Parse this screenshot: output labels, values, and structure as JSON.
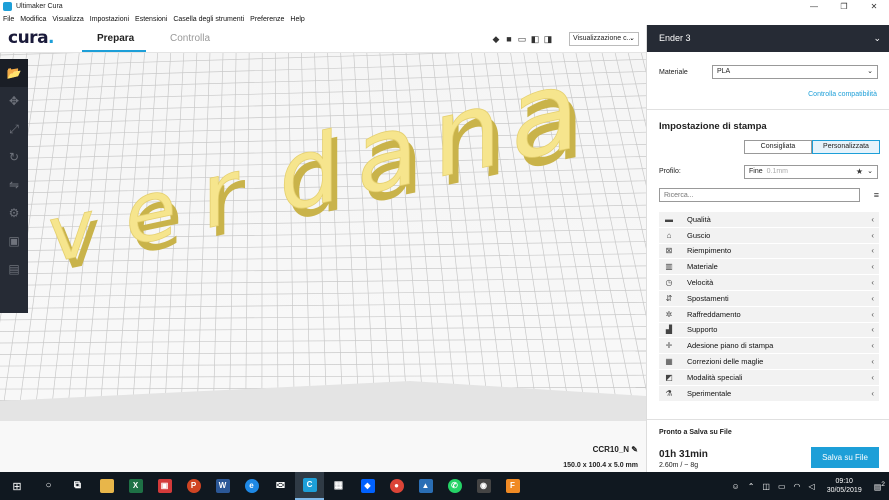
{
  "window": {
    "title": "Ultimaker Cura",
    "controls": [
      "—",
      "❐",
      "✕"
    ]
  },
  "menu": [
    "File",
    "Modifica",
    "Visualizza",
    "Impostazioni",
    "Estensioni",
    "Casella degli strumenti",
    "Preferenze",
    "Help"
  ],
  "header": {
    "logo": "cura",
    "logo_dot": ".",
    "tabs": [
      {
        "label": "Prepara",
        "active": true
      },
      {
        "label": "Controlla",
        "active": false
      }
    ],
    "view_select": "Visualizzazione c..."
  },
  "viewport": {
    "model_text": "verdana",
    "model_color": "#f6e58d",
    "model_name": "CCR10_N",
    "model_dims": "150.0 x 100.4 x 5.0 mm"
  },
  "panel": {
    "printer": "Ender 3",
    "material_label": "Materiale",
    "material_value": "PLA",
    "compat_link": "Controlla compatibilità",
    "section_title": "Impostazione di stampa",
    "mode_recommended": "Consigliata",
    "mode_custom": "Personalizzata",
    "profile_label": "Profilo:",
    "profile_value": "Fine",
    "profile_sub": "0.1mm",
    "search_placeholder": "Ricerca...",
    "categories": [
      {
        "label": "Qualità",
        "icon": "quality-icon"
      },
      {
        "label": "Guscio",
        "icon": "shell-icon"
      },
      {
        "label": "Riempimento",
        "icon": "infill-icon"
      },
      {
        "label": "Materiale",
        "icon": "material-icon"
      },
      {
        "label": "Velocità",
        "icon": "speed-icon"
      },
      {
        "label": "Spostamenti",
        "icon": "travel-icon"
      },
      {
        "label": "Raffreddamento",
        "icon": "cooling-icon"
      },
      {
        "label": "Supporto",
        "icon": "support-icon"
      },
      {
        "label": "Adesione piano di stampa",
        "icon": "adhesion-icon"
      },
      {
        "label": "Correzioni delle maglie",
        "icon": "mesh-fix-icon"
      },
      {
        "label": "Modalità speciali",
        "icon": "special-modes-icon"
      },
      {
        "label": "Sperimentale",
        "icon": "experimental-icon"
      }
    ],
    "ready_text": "Pronto a Salva su File",
    "time": "01h 31min",
    "weight": "2.60m / ~ 8g",
    "save_button": "Salva su File"
  },
  "taskbar": {
    "time": "09:10",
    "date": "30/05/2019",
    "notifications": "2",
    "accent": "#1d9fd8"
  }
}
